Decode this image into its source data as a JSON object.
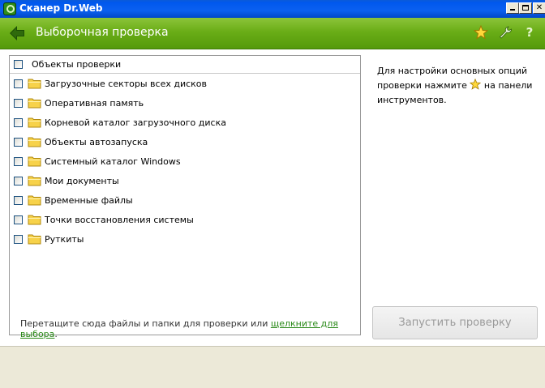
{
  "window": {
    "title": "Сканер Dr.Web"
  },
  "header": {
    "title": "Выборочная проверка"
  },
  "colors": {
    "header_green": "#6aad17",
    "titlebar_blue": "#0058ee",
    "link_green": "#2b8a1a",
    "folder_yellow": "#f7d24a"
  },
  "panel": {
    "header_label": "Объекты проверки",
    "items": [
      {
        "label": "Загрузочные секторы всех дисков",
        "checked": false
      },
      {
        "label": "Оперативная память",
        "checked": false
      },
      {
        "label": "Корневой каталог загрузочного диска",
        "checked": false
      },
      {
        "label": "Объекты автозапуска",
        "checked": false
      },
      {
        "label": "Системный каталог Windows",
        "checked": false
      },
      {
        "label": "Мои документы",
        "checked": false
      },
      {
        "label": "Временные файлы",
        "checked": false
      },
      {
        "label": "Точки восстановления системы",
        "checked": false
      },
      {
        "label": "Руткиты",
        "checked": false
      }
    ],
    "hint_text": "Перетащите сюда файлы и папки для проверки или ",
    "hint_link": "щелкните для выбора",
    "hint_end": "."
  },
  "sidebar": {
    "text_before": "Для настройки основных опций проверки нажмите ",
    "text_after": " на панели инструментов.",
    "run_button": "Запустить проверку"
  }
}
